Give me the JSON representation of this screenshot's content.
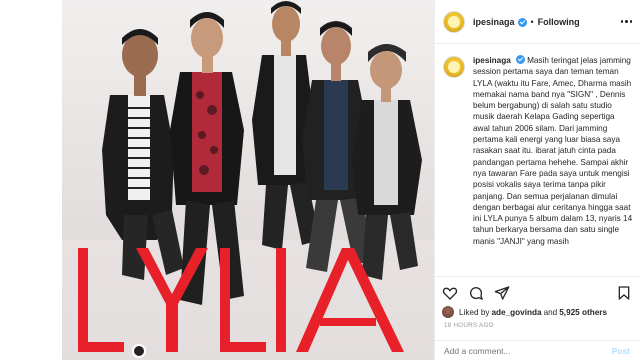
{
  "post": {
    "brand_text": "LYLA"
  },
  "header": {
    "username": "ipesinaga",
    "separator": "•",
    "follow_state": "Following"
  },
  "caption": {
    "username": "ipesinaga",
    "text": "Masih teringat jelas jamming session pertama saya dan teman teman LYLA (waktu itu Fare, Amec, Dharma masih memakai nama band nya \"SIGN\" , Dennis belum bergabung) di salah satu studio musik daerah Kelapa Gading sepertiga awal tahun 2006 silam. Dari jamming pertama kali energi yang luar biasa saya rasakan saat itu. ibarat jatuh cinta pada pandangan pertama hehehe. Sampai akhir nya tawaran Fare pada saya untuk mengisi posisi vokalis saya terima tanpa pikir panjang. Dan semua perjalanan dimulai dengan berbagai alur ceritanya hingga saat ini LYLA punya 5 album dalam 13, nyaris 14 tahun berkarya bersama dan satu single manis \"JANJI\" yang masih"
  },
  "actions": {
    "like_icon": "heart-icon",
    "comment_icon": "comment-icon",
    "share_icon": "share-icon",
    "save_icon": "bookmark-icon"
  },
  "likes": {
    "prefix": "Liked by",
    "first_user": "ade_govinda",
    "connector": "and",
    "others": "5,925 others"
  },
  "timestamp": "18 HOURS AGO",
  "comment": {
    "placeholder": "Add a comment...",
    "post_label": "Post"
  },
  "colors": {
    "brand_red": "#e8202a",
    "verified_blue": "#3897f0",
    "post_button": "#b2dffc"
  }
}
